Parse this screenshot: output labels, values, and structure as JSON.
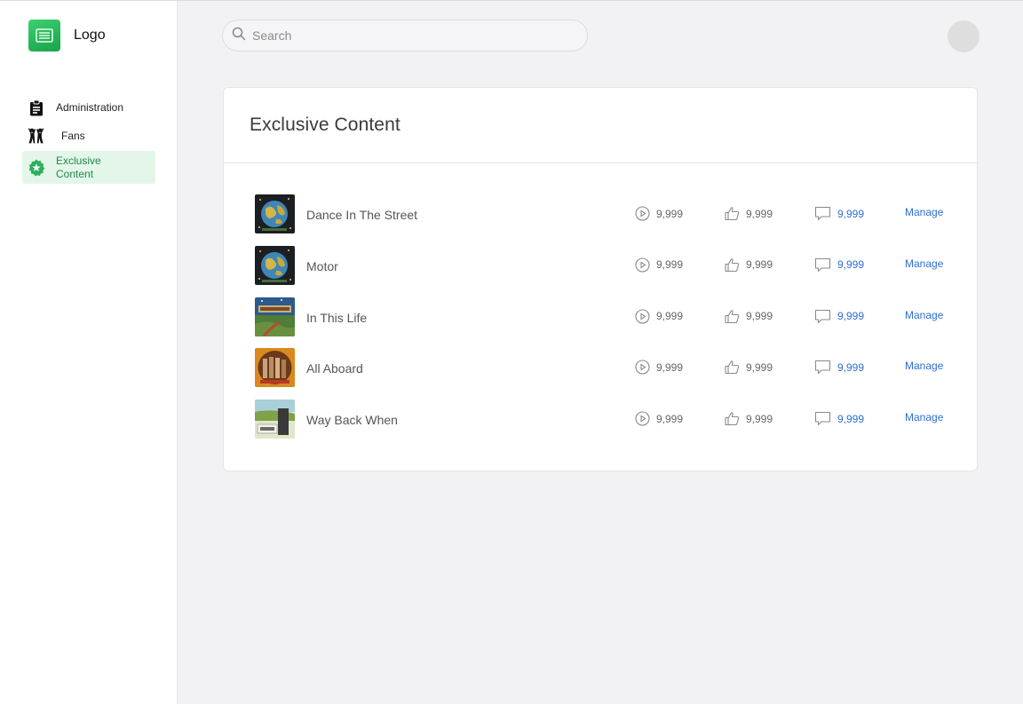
{
  "brand": {
    "logo_text": "Logo"
  },
  "nav": [
    {
      "label": "Administration",
      "icon": "clipboard-icon"
    },
    {
      "label": "Fans",
      "icon": "people-icon"
    },
    {
      "label": "Exclusive Content",
      "icon": "star-badge-icon",
      "active": true
    }
  ],
  "search": {
    "placeholder": "Search",
    "value": ""
  },
  "main": {
    "title": "Exclusive Content",
    "items": [
      {
        "title": "Dance In The Street",
        "plays": "9,999",
        "likes": "9,999",
        "comments": "9,999",
        "action": "Manage"
      },
      {
        "title": "Motor",
        "plays": "9,999",
        "likes": "9,999",
        "comments": "9,999",
        "action": "Manage"
      },
      {
        "title": "In This Life",
        "plays": "9,999",
        "likes": "9,999",
        "comments": "9,999",
        "action": "Manage"
      },
      {
        "title": "All Aboard",
        "plays": "9,999",
        "likes": "9,999",
        "comments": "9,999",
        "action": "Manage"
      },
      {
        "title": "Way Back When",
        "plays": "9,999",
        "likes": "9,999",
        "comments": "9,999",
        "action": "Manage"
      }
    ]
  },
  "colors": {
    "accent": "#2f6fd0",
    "brand_green": "#1f8a47",
    "active_bg": "#e4f6ea"
  }
}
